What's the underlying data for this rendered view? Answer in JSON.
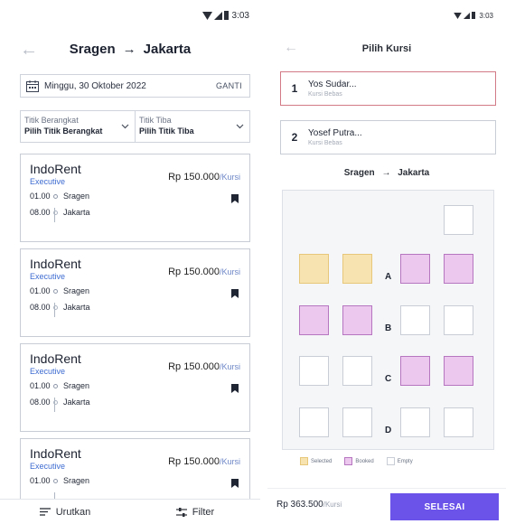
{
  "left": {
    "status": {
      "time": "3:03"
    },
    "header": {
      "from": "Sragen",
      "arrow": "→",
      "to": "Jakarta"
    },
    "date": {
      "value": "Minggu, 30 Oktober 2022",
      "action": "GANTI"
    },
    "departure": {
      "label": "Titik Berangkat",
      "value": "Pilih Titik Berangkat"
    },
    "arrival": {
      "label": "Titik Tiba",
      "value": "Pilih Titik Tiba"
    },
    "trips": [
      {
        "operator": "IndoRent",
        "class": "Executive",
        "price": "Rp 150.000",
        "unit": "/Kursi",
        "dep_time": "01.00",
        "dep_city": "Sragen",
        "arr_time": "08.00",
        "arr_city": "Jakarta"
      },
      {
        "operator": "IndoRent",
        "class": "Executive",
        "price": "Rp 150.000",
        "unit": "/Kursi",
        "dep_time": "01.00",
        "dep_city": "Sragen",
        "arr_time": "08.00",
        "arr_city": "Jakarta"
      },
      {
        "operator": "IndoRent",
        "class": "Executive",
        "price": "Rp 150.000",
        "unit": "/Kursi",
        "dep_time": "01.00",
        "dep_city": "Sragen",
        "arr_time": "08.00",
        "arr_city": "Jakarta"
      },
      {
        "operator": "IndoRent",
        "class": "Executive",
        "price": "Rp 150.000",
        "unit": "/Kursi",
        "dep_time": "01.00",
        "dep_city": "Sragen",
        "arr_time": "",
        "arr_city": ""
      }
    ],
    "bottom": {
      "sort": "Urutkan",
      "filter": "Filter"
    }
  },
  "right": {
    "status": {
      "time": "3:03"
    },
    "title": "Pilih Kursi",
    "passengers": [
      {
        "num": "1",
        "name": "Yos Sudar...",
        "sub": "Kursi Bebas"
      },
      {
        "num": "2",
        "name": "Yosef Putra...",
        "sub": "Kursi Bebas"
      }
    ],
    "route": {
      "from": "Sragen",
      "arrow": "→",
      "to": "Jakarta"
    },
    "rows": [
      "A",
      "B",
      "C",
      "D"
    ],
    "seat_states": {
      "driver_side": "empty",
      "A": [
        "selected",
        "selected",
        "booked",
        "booked"
      ],
      "B": [
        "booked",
        "booked",
        "empty",
        "empty"
      ],
      "C": [
        "empty",
        "empty",
        "booked",
        "booked"
      ],
      "D": [
        "empty",
        "empty",
        "empty",
        "empty"
      ]
    },
    "legend": {
      "selected": "Selected",
      "booked": "Booked",
      "empty": "Empty"
    },
    "colors": {
      "selected": "#f7e3b0",
      "booked": "#ecc8ee",
      "accent": "#6b52e8"
    },
    "total": {
      "amount": "Rp 363.500",
      "unit": "/Kursi"
    },
    "submit": "SELESAI"
  }
}
